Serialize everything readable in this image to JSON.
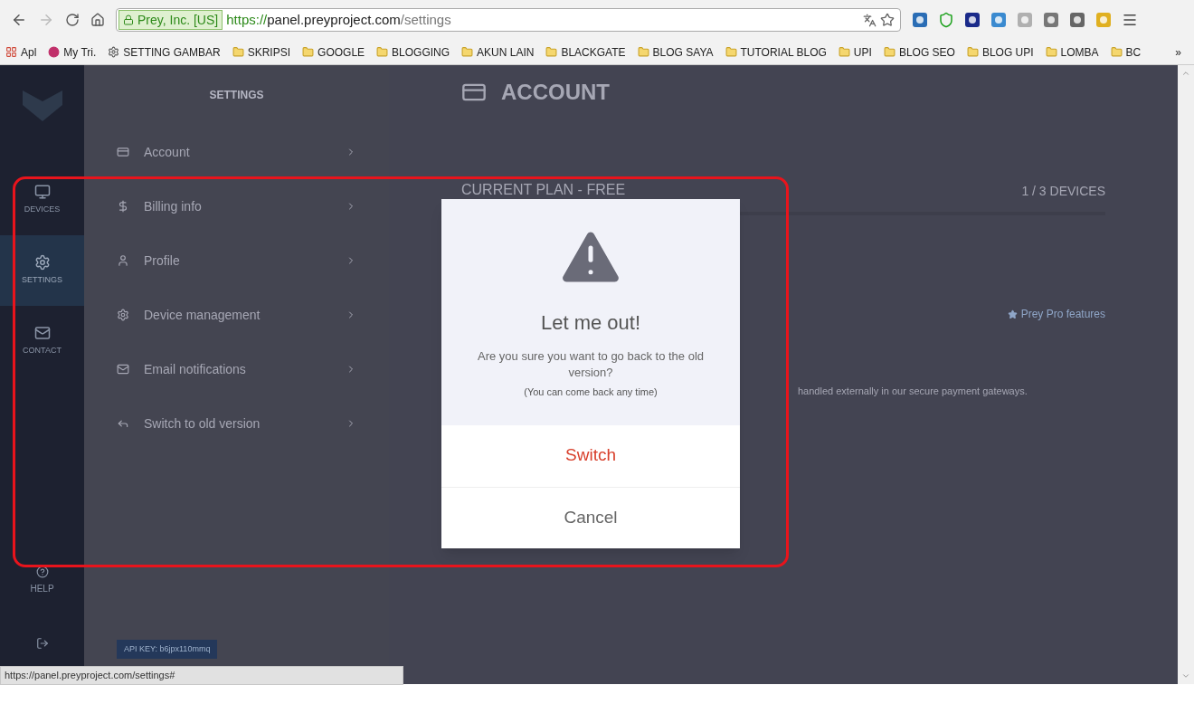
{
  "browser": {
    "security_label": "Prey, Inc. [US]",
    "url_scheme": "https://",
    "url_host": "panel.preyproject.com",
    "url_path": "/settings",
    "bookmarks": [
      {
        "label": "Apl",
        "kind": "apps"
      },
      {
        "label": "My Tri.",
        "kind": "site"
      },
      {
        "label": "SETTING GAMBAR",
        "kind": "gear"
      },
      {
        "label": "SKRIPSI",
        "kind": "folder"
      },
      {
        "label": "GOOGLE",
        "kind": "folder"
      },
      {
        "label": "BLOGGING",
        "kind": "folder"
      },
      {
        "label": "AKUN LAIN",
        "kind": "folder"
      },
      {
        "label": "BLACKGATE",
        "kind": "folder"
      },
      {
        "label": "BLOG SAYA",
        "kind": "folder"
      },
      {
        "label": "TUTORIAL BLOG",
        "kind": "folder"
      },
      {
        "label": "UPI",
        "kind": "folder"
      },
      {
        "label": "BLOG SEO",
        "kind": "folder"
      },
      {
        "label": "BLOG UPI",
        "kind": "folder"
      },
      {
        "label": "LOMBA",
        "kind": "folder"
      },
      {
        "label": "BC",
        "kind": "folder"
      }
    ],
    "bookmarks_overflow": "»",
    "status_url": "https://panel.preyproject.com/settings#"
  },
  "nav": {
    "items": [
      {
        "label": "DEVICES",
        "kind": "devices",
        "selected": false
      },
      {
        "label": "SETTINGS",
        "kind": "settings",
        "selected": true
      },
      {
        "label": "CONTACT",
        "kind": "contact",
        "selected": false
      }
    ],
    "bottom": [
      {
        "label": "HELP",
        "kind": "help"
      },
      {
        "kind": "logout"
      }
    ]
  },
  "settings_panel": {
    "title": "SETTINGS",
    "items": [
      {
        "label": "Account",
        "kind": "account"
      },
      {
        "label": "Billing info",
        "kind": "billing"
      },
      {
        "label": "Profile",
        "kind": "profile"
      },
      {
        "label": "Device management",
        "kind": "device"
      },
      {
        "label": "Email notifications",
        "kind": "email"
      },
      {
        "label": "Switch to old version",
        "kind": "switch"
      }
    ],
    "api_key": "API KEY: b6jpx110mmq"
  },
  "content": {
    "title": "ACCOUNT",
    "plan": "CURRENT PLAN - FREE",
    "devices": "1 / 3 DEVICES",
    "link": "Prey Pro features",
    "note": "handled externally in our secure payment gateways."
  },
  "dialog": {
    "title": "Let me out!",
    "message": "Are you sure you want to go back to the old version?",
    "hint": "(You can come back any time)",
    "buttons": [
      {
        "label": "Switch",
        "kind": "danger"
      },
      {
        "label": "Cancel",
        "kind": "default"
      }
    ]
  }
}
